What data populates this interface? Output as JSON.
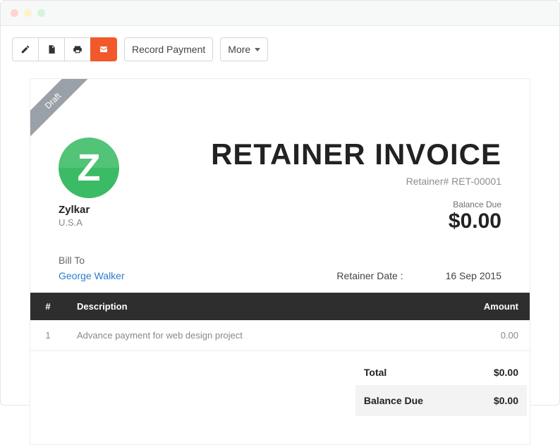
{
  "ribbon": "Draft",
  "toolbar": {
    "record_payment": "Record Payment",
    "more": "More"
  },
  "company": {
    "logo_letter": "Z",
    "name": "Zylkar",
    "country": "U.S.A"
  },
  "invoice": {
    "title": "RETAINER INVOICE",
    "number_label": "Retainer# RET-00001",
    "balance_label": "Balance Due",
    "balance_value": "$0.00",
    "bill_to_label": "Bill To",
    "bill_to_name": "George Walker",
    "date_label": "Retainer Date :",
    "date_value": "16 Sep 2015"
  },
  "table": {
    "headers": {
      "num": "#",
      "desc": "Description",
      "amount": "Amount"
    },
    "rows": [
      {
        "num": "1",
        "desc": "Advance payment for web design project",
        "amount": "0.00"
      }
    ]
  },
  "totals": {
    "total_label": "Total",
    "total_value": "$0.00",
    "balance_label": "Balance Due",
    "balance_value": "$0.00"
  }
}
